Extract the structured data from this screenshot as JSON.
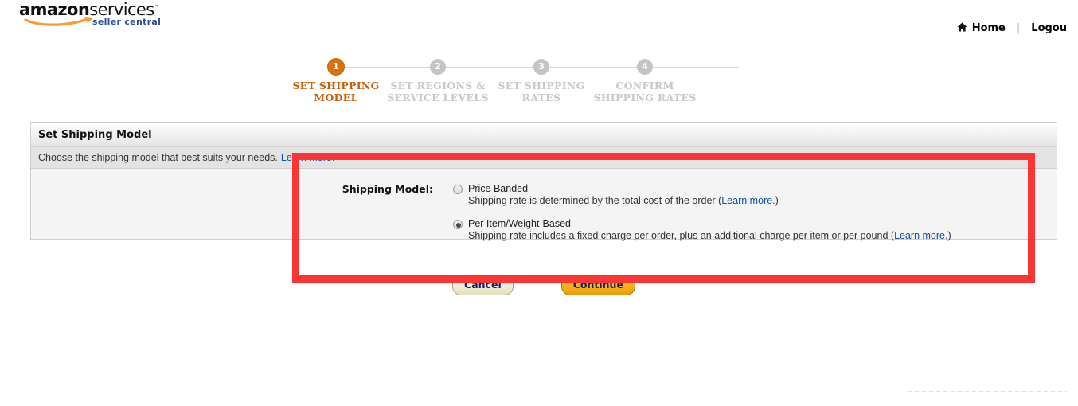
{
  "header": {
    "logo": {
      "word_bold": "amazon",
      "word_light": "services",
      "trademark": "™",
      "subtitle": "seller central"
    },
    "nav": {
      "home_icon": "home-icon",
      "home_label": "Home",
      "separator": "|",
      "logout_label": "Logou"
    }
  },
  "wizard": {
    "steps": [
      {
        "number": "1",
        "label": "SET SHIPPING MODEL",
        "state": "active"
      },
      {
        "number": "2",
        "label": "SET REGIONS & SERVICE LEVELS",
        "state": "inactive"
      },
      {
        "number": "3",
        "label": "SET SHIPPING RATES",
        "state": "inactive"
      },
      {
        "number": "4",
        "label": "CONFIRM SHIPPING RATES",
        "state": "inactive"
      }
    ],
    "active_color": "#d9730d",
    "inactive_color": "#c4c4c4"
  },
  "panel": {
    "title": "Set Shipping Model",
    "description": "Choose the shipping model that best suits your needs.",
    "description_link": "Learn more.",
    "form": {
      "label": "Shipping Model:",
      "options": [
        {
          "title": "Price Banded",
          "description_before": "Shipping rate is determined by the total cost of the order (",
          "link": "Learn more.",
          "description_after": ")",
          "selected": false
        },
        {
          "title": "Per Item/Weight-Based",
          "description_before": "Shipping rate includes a fixed charge per order, plus an additional charge per item or per pound (",
          "link": "Learn more.",
          "description_after": ")",
          "selected": true
        }
      ]
    }
  },
  "actions": {
    "cancel_label": "Cancel",
    "continue_label": "Continue"
  },
  "annotation": {
    "color": "#fa3535",
    "shape": "rectangle-highlight"
  },
  "link_color": "#0d4fa0"
}
